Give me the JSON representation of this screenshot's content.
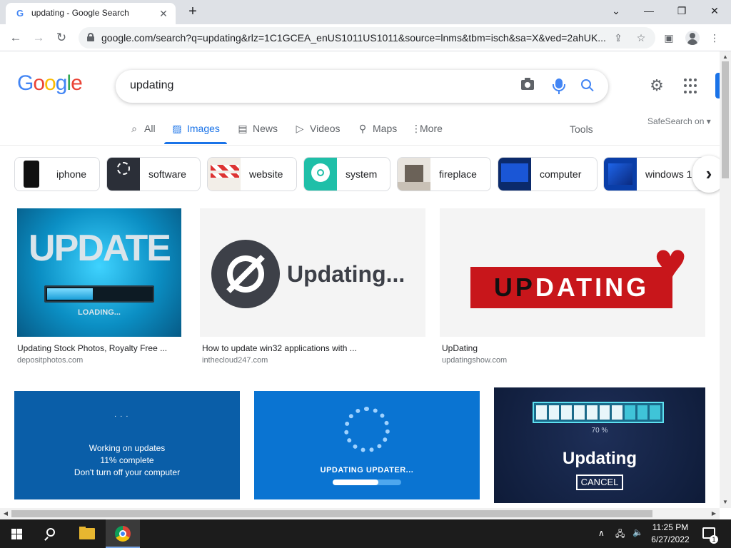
{
  "browser": {
    "tab_title": "updating - Google Search",
    "tab_favicon": "google-g-icon",
    "new_tab_label": "+",
    "url": "google.com/search?q=updating&rlz=1C1GCEA_enUS1011US1011&source=lnms&tbm=isch&sa=X&ved=2ahUK...",
    "window_controls": [
      "minimize-icon",
      "maximize-icon",
      "close-icon"
    ]
  },
  "header": {
    "logo": "Google",
    "search_query": "updating",
    "icons": [
      "camera-icon",
      "microphone-icon",
      "search-icon",
      "gear-icon",
      "apps-grid-icon"
    ]
  },
  "nav": {
    "tabs": [
      {
        "label": "All",
        "icon": "search-icon"
      },
      {
        "label": "Images",
        "icon": "image-icon"
      },
      {
        "label": "News",
        "icon": "news-icon"
      },
      {
        "label": "Videos",
        "icon": "play-icon"
      },
      {
        "label": "Maps",
        "icon": "pin-icon"
      },
      {
        "label": "More",
        "icon": "more-vertical-icon"
      }
    ],
    "tools_label": "Tools",
    "safesearch_label": "SafeSearch on"
  },
  "chips": [
    {
      "label": "iphone"
    },
    {
      "label": "software"
    },
    {
      "label": "website"
    },
    {
      "label": "system"
    },
    {
      "label": "fireplace"
    },
    {
      "label": "computer"
    },
    {
      "label": "windows 1"
    }
  ],
  "results": [
    {
      "title": "Updating Stock Photos, Royalty Free ...",
      "source": "depositphotos.com",
      "image_text": "UPDATE",
      "image_sub": "LOADING..."
    },
    {
      "title": "How to update win32 applications with ...",
      "source": "inthecloud247.com",
      "image_text": "Updating..."
    },
    {
      "title": "UpDating",
      "source": "updatingshow.com",
      "image_text": "UPDATING"
    },
    {
      "title": "",
      "source": "",
      "image_lines": [
        "Working on updates",
        "11% complete",
        "Don't turn off your computer"
      ]
    },
    {
      "title": "",
      "source": "",
      "image_text": "UPDATING UPDATER..."
    },
    {
      "title": "",
      "source": "",
      "image_text": "Updating",
      "image_percent": "70 %",
      "image_button": "CANCEL"
    }
  ],
  "taskbar": {
    "time": "11:25 PM",
    "date": "6/27/2022",
    "notification_count": "1"
  },
  "colors": {
    "google_blue": "#4285f4",
    "google_red": "#ea4335",
    "google_yellow": "#fbbc05",
    "google_green": "#34a853",
    "link_blue": "#1a73e8"
  }
}
